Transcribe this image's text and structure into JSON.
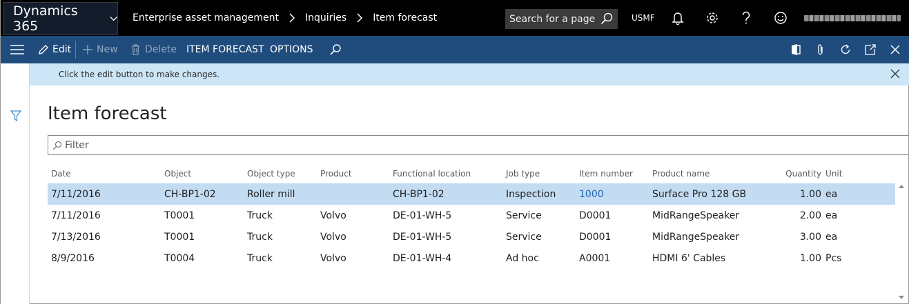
{
  "app": {
    "title": "Dynamics 365"
  },
  "breadcrumb": [
    "Enterprise asset management",
    "Inquiries",
    "Item forecast"
  ],
  "search": {
    "placeholder": "Search for a page"
  },
  "company": "USMF",
  "actions": {
    "edit": "Edit",
    "new": "New",
    "delete": "Delete",
    "item_forecast": "ITEM FORECAST",
    "options": "OPTIONS"
  },
  "message": "Click the edit button to make changes.",
  "page": {
    "title": "Item forecast"
  },
  "filter": {
    "placeholder": "Filter"
  },
  "grid": {
    "columns": [
      "Date",
      "Object",
      "Object type",
      "Product",
      "Functional location",
      "Job type",
      "Item number",
      "Product name",
      "Quantity",
      "Unit"
    ],
    "rows": [
      {
        "date": "7/11/2016",
        "object": "CH-BP1-02",
        "object_type": "Roller mill",
        "product": "",
        "location": "CH-BP1-02",
        "job_type": "Inspection",
        "item": "1000",
        "product_name": "Surface Pro 128 GB",
        "qty": "1.00",
        "unit": "ea"
      },
      {
        "date": "7/11/2016",
        "object": "T0001",
        "object_type": "Truck",
        "product": "Volvo",
        "location": "DE-01-WH-5",
        "job_type": "Service",
        "item": "D0001",
        "product_name": "MidRangeSpeaker",
        "qty": "2.00",
        "unit": "ea"
      },
      {
        "date": "7/13/2016",
        "object": "T0001",
        "object_type": "Truck",
        "product": "Volvo",
        "location": "DE-01-WH-5",
        "job_type": "Service",
        "item": "D0001",
        "product_name": "MidRangeSpeaker",
        "qty": "3.00",
        "unit": "ea"
      },
      {
        "date": "8/9/2016",
        "object": "T0004",
        "object_type": "Truck",
        "product": "Volvo",
        "location": "DE-01-WH-4",
        "job_type": "Ad hoc",
        "item": "A0001",
        "product_name": "HDMI 6' Cables",
        "qty": "1.00",
        "unit": "Pcs"
      }
    ]
  },
  "colors": {
    "topbar": "#000000",
    "actionbar": "#1f4c7d",
    "message": "#cde6f7",
    "selected_row": "#c4dcf2",
    "link": "#1f64b4"
  }
}
